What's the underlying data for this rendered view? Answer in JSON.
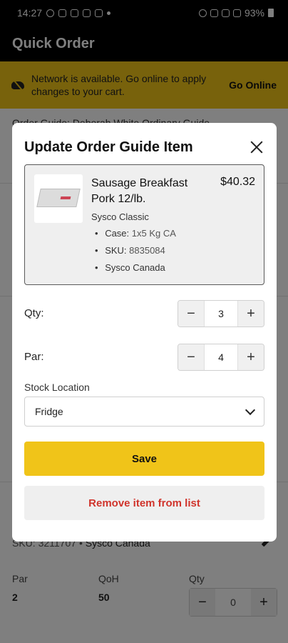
{
  "status_bar": {
    "time": "14:27",
    "battery": "93%"
  },
  "app": {
    "title": "Quick Order"
  },
  "banner": {
    "message": "Network is available. Go online to apply changes to your cart.",
    "action": "Go Online"
  },
  "background": {
    "partial_heading": "Order Guide: Deborah White Ordinary Guide",
    "sku_label": "SKU:",
    "sku_value": "3211707",
    "distributor": "Sysco Canada",
    "par_label": "Par",
    "par_value": "2",
    "qoh_label": "QoH",
    "qoh_value": "50",
    "qty_label": "Qty",
    "qty_value": "0",
    "minus": "−",
    "plus": "+"
  },
  "modal": {
    "title": "Update Order Guide Item",
    "item": {
      "name": "Sausage Breakfast Pork 12/lb.",
      "price": "$40.32",
      "brand": "Sysco Classic",
      "case_label": "Case:",
      "case_value": "1x5 Kg CA",
      "sku_label": "SKU:",
      "sku_value": "8835084",
      "distributor": "Sysco Canada"
    },
    "qty": {
      "label": "Qty:",
      "value": "3"
    },
    "par": {
      "label": "Par:",
      "value": "4"
    },
    "stepper_minus": "−",
    "stepper_plus": "+",
    "stock_location": {
      "label": "Stock Location",
      "value": "Fridge"
    },
    "save_label": "Save",
    "remove_label": "Remove item from list"
  },
  "colors": {
    "accent": "#f0c419",
    "danger": "#d0342c"
  }
}
